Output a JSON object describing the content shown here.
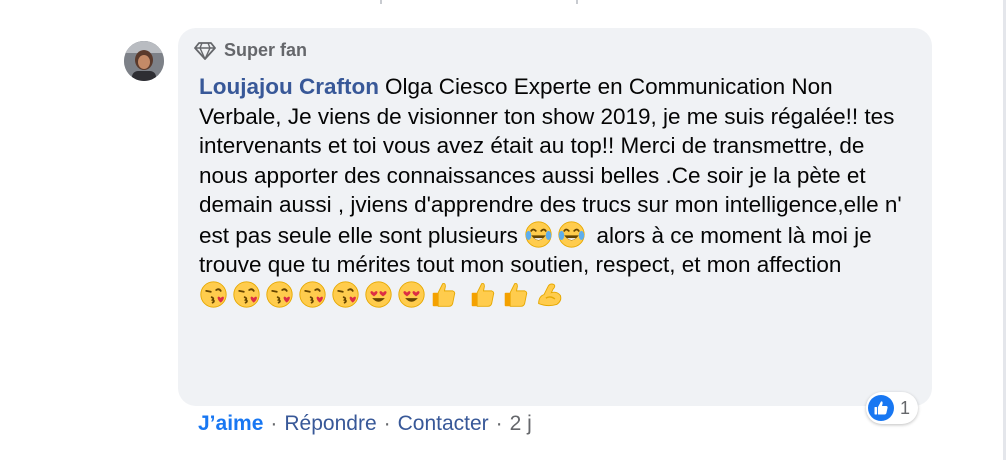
{
  "comment": {
    "badge_label": "Super fan",
    "author": "Loujajou Crafton",
    "text": "Olga Ciesco Experte en Communication Non Verbale, Je viens de visionner ton show 2019, je me suis régalée!! tes intervenants et toi vous avez était au top!! Merci de transmettre, de nous apporter des connaissances aussi belles .Ce soir je la pète et demain aussi , jviens d'apprendre des trucs sur mon intelligence,elle n' est pas seule elle sont plusieurs",
    "text_continued": "alors à ce moment là moi je trouve que tu mérites tout mon soutien, respect, et mon affection",
    "emoji_after_text": [
      "face-with-tears-of-joy",
      "face-with-tears-of-joy"
    ],
    "emoji_trailing": [
      "face-blowing-a-kiss",
      "face-blowing-a-kiss",
      "face-blowing-a-kiss",
      "face-blowing-a-kiss",
      "face-blowing-a-kiss",
      "smiling-face-with-heart-eyes",
      "smiling-face-with-heart-eyes",
      "thumbs-up",
      "thumbs-up",
      "thumbs-up",
      "flexed-biceps"
    ]
  },
  "reactions": {
    "type": "like-icon",
    "count": "1"
  },
  "actions": {
    "like_label": "J’aime",
    "separator": "·",
    "reply_label": "Répondre",
    "contact_label": "Contacter",
    "timestamp": "2 j"
  },
  "colors": {
    "bubble_bg": "#f0f2f5",
    "author_link": "#385898",
    "like_blue": "#1877f2",
    "secondary_text": "#65676b"
  }
}
